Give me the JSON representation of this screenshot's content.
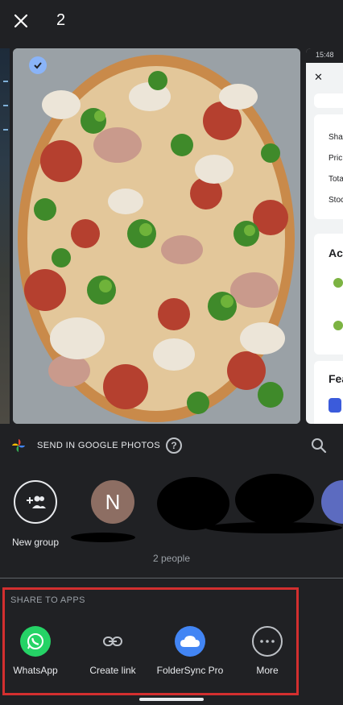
{
  "header": {
    "close_icon": "close-icon",
    "selected_count": "2"
  },
  "carousel": {
    "right_card": {
      "status_time": "15:48",
      "rows": [
        "Sha",
        "Pric",
        "Tota",
        "Stoc"
      ],
      "section_1": "Act",
      "section_2": "Fea"
    }
  },
  "google_photos": {
    "title": "SEND IN GOOGLE PHOTOS",
    "help_icon": "help-icon",
    "search_icon": "search-icon"
  },
  "contacts": {
    "new_group_label": "New group",
    "contact_initial": "N",
    "contact_color": "#8d6e63",
    "people_label": "2 people"
  },
  "share_to_apps": {
    "title": "SHARE TO APPS",
    "apps": [
      {
        "label": "WhatsApp",
        "icon": "whatsapp-icon",
        "color": "#25d366"
      },
      {
        "label": "Create link",
        "icon": "link-icon",
        "color": "#202124"
      },
      {
        "label": "FolderSync Pro",
        "icon": "cloud-icon",
        "color": "#4285f4"
      },
      {
        "label": "More",
        "icon": "more-icon",
        "color": "#202124"
      }
    ]
  }
}
